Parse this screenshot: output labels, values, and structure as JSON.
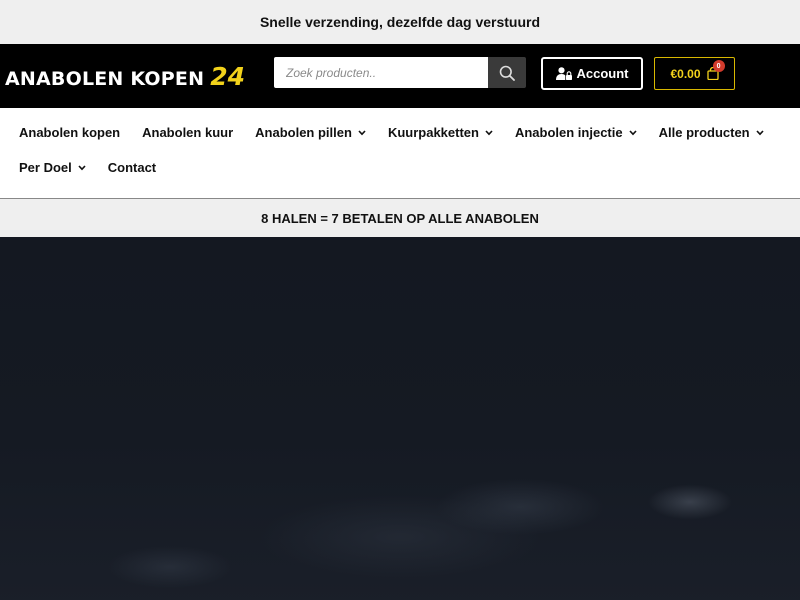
{
  "topbar": {
    "text": "Snelle verzending, dezelfde dag verstuurd"
  },
  "header": {
    "logo_text": "ANABOLEN KOPEN",
    "logo_number": "24",
    "search": {
      "placeholder": "Zoek producten..",
      "value": ""
    },
    "account_label": "Account",
    "cart_total": "€0.00",
    "cart_count": "0"
  },
  "nav": {
    "row1": [
      {
        "label": "Anabolen kopen",
        "dropdown": false
      },
      {
        "label": "Anabolen kuur",
        "dropdown": false
      },
      {
        "label": "Anabolen pillen",
        "dropdown": true
      },
      {
        "label": "Kuurpakketten",
        "dropdown": true
      },
      {
        "label": "Anabolen injectie",
        "dropdown": true
      },
      {
        "label": "Alle producten",
        "dropdown": true
      }
    ],
    "row2": [
      {
        "label": "Per Doel",
        "dropdown": true
      },
      {
        "label": "Contact",
        "dropdown": false
      }
    ]
  },
  "promo": {
    "text": "8 HALEN = 7 BETALEN OP ALLE ANABOLEN"
  },
  "colors": {
    "accent": "#f2d21b",
    "header_bg": "#000000",
    "badge": "#d23b2c"
  },
  "icons": {
    "search": "search-icon",
    "account": "user-lock-icon",
    "cart": "shopping-bag-icon",
    "dropdown": "chevron-down-icon"
  }
}
